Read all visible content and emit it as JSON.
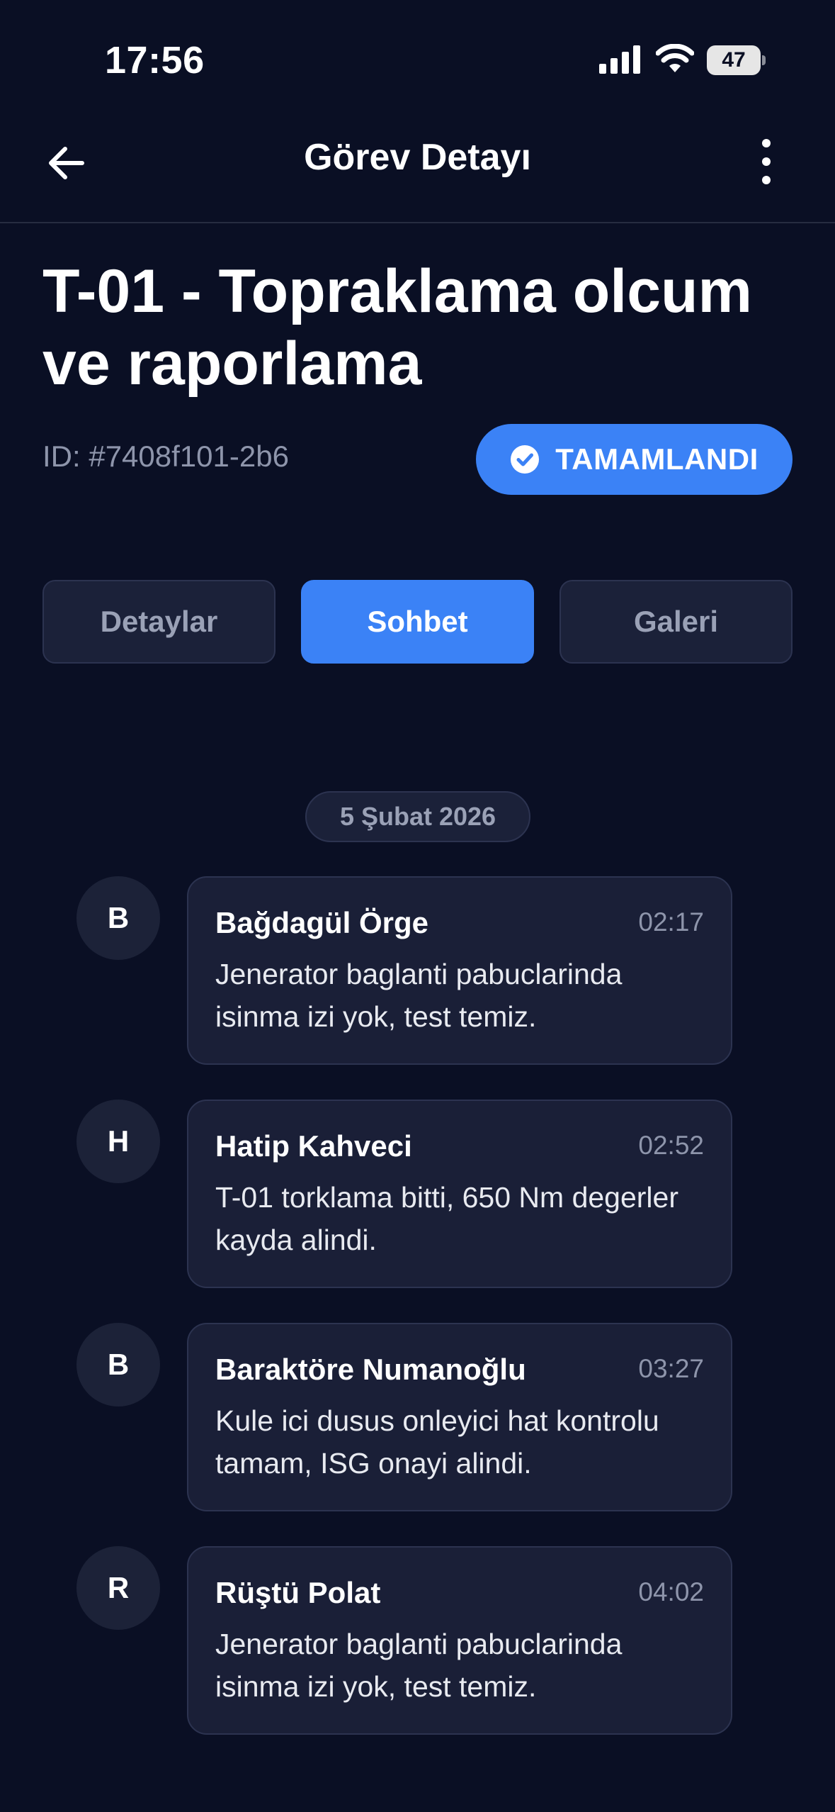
{
  "status_bar": {
    "time": "17:56",
    "battery": "47",
    "icons": [
      "signal-icon",
      "wifi-icon",
      "battery-icon"
    ]
  },
  "nav": {
    "title": "Görev Detayı",
    "back_icon": "arrow-left-icon",
    "more_icon": "more-vertical-icon"
  },
  "task": {
    "title": "T-01 - Topraklama olcum ve raporlama",
    "id": "ID: #7408f101-2b6",
    "status": "TAMAMLANDI",
    "status_icon": "check-circle-icon",
    "status_color": "#3b82f6"
  },
  "tabs": [
    {
      "label": "Detaylar",
      "active": false
    },
    {
      "label": "Sohbet",
      "active": true
    },
    {
      "label": "Galeri",
      "active": false
    }
  ],
  "chat": {
    "date": "5 Şubat 2026",
    "messages": [
      {
        "initial": "B",
        "sender": "Bağdagül Örge",
        "time": "02:17",
        "text": "Jenerator baglanti pabuclarinda isinma izi yok, test temiz."
      },
      {
        "initial": "H",
        "sender": "Hatip Kahveci",
        "time": "02:52",
        "text": "T-01 torklama bitti, 650 Nm degerler kayda alindi."
      },
      {
        "initial": "B",
        "sender": "Baraktöre Numanoğlu",
        "time": "03:27",
        "text": "Kule ici dusus onleyici hat kontrolu tamam, ISG onayi alindi."
      },
      {
        "initial": "R",
        "sender": "Rüştü Polat",
        "time": "04:02",
        "text": "Jenerator baglanti pabuclarinda isinma izi yok, test temiz."
      }
    ]
  },
  "colors": {
    "background": "#0a0f24",
    "accent": "#3b82f6",
    "bubble": "#1a1f37"
  }
}
